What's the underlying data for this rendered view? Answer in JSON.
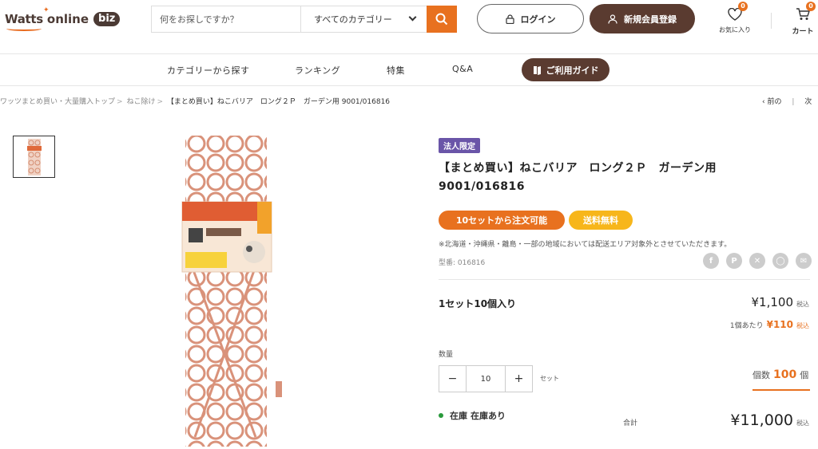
{
  "header": {
    "logo": {
      "watts": "Watts",
      "online": "online",
      "biz": "biz"
    },
    "search_placeholder": "何をお探しですか？",
    "category_select": "すべてのカテゴリー",
    "login_label": "ログイン",
    "register_label": "新規会員登録",
    "favorites_label": "お気に入り",
    "favorites_count": "0",
    "cart_label": "カート",
    "cart_count": "0"
  },
  "nav": {
    "items": [
      "カテゴリーから探す",
      "ランキング",
      "特集",
      "Q&A"
    ],
    "guide_label": "ご利用ガイド"
  },
  "breadcrumb": {
    "items": [
      "ワッツまとめ買い・大量購入トップ",
      "ねこ除け"
    ],
    "current": "【まとめ買い】ねこバリア　ロング２Ｐ　ガーデン用 9001/016816",
    "prev": "前の",
    "next": "次"
  },
  "product": {
    "tag": "法人限定",
    "title_line1": "【まとめ買い】ねこバリア　ロング２Ｐ　ガーデン用",
    "title_line2": "9001/016816",
    "min_order": "10セットから注文可能",
    "free_shipping": "送料無料",
    "shipping_note": "※北海道・沖縄県・離島・一部の地域においては配送エリア対象外とさせていただきます。",
    "model": "型番: 016816",
    "share_icons": [
      "facebook-icon",
      "pinterest-icon",
      "x-icon",
      "line-icon",
      "mail-icon"
    ],
    "set_label": "1セット10個入り",
    "price": "¥1,100",
    "tax_label": "税込",
    "unit_label": "1個あたり",
    "unit_price": "¥110",
    "qty_label": "数量",
    "qty_value": "10",
    "qty_unit": "セット",
    "count_label": "個数",
    "count_value": "100",
    "count_unit": "個",
    "stock_label": "在庫",
    "stock_value": "在庫あり",
    "total_label": "合計",
    "total": "¥11,000"
  },
  "colors": {
    "accent": "#e8711f",
    "brand": "#5a3b30",
    "tag": "#6a55a8",
    "shipping": "#f7b61b"
  }
}
